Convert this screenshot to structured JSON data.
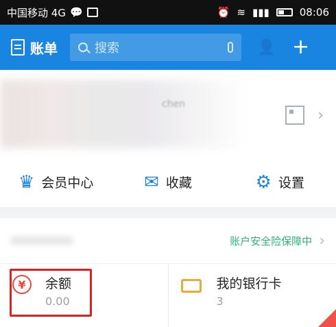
{
  "status_bar": {
    "carrier": "中国移动 4G",
    "time": "08:06"
  },
  "app_bar": {
    "title": "账单",
    "search_placeholder": "搜索"
  },
  "profile": {
    "name_fragment": "chen"
  },
  "quick_actions": {
    "vip": "会员中心",
    "favorites": "收藏",
    "settings": "设置"
  },
  "security_banner": {
    "text": "账户安全险保障中"
  },
  "cards": {
    "balance": {
      "title": "余额",
      "value": "0.00"
    },
    "bank": {
      "title": "我的银行卡",
      "value": "3"
    }
  },
  "colors": {
    "primary": "#1a85e0",
    "green": "#2db37a",
    "red": "#e24a3a",
    "orange": "#f0a63a",
    "highlight": "#e21f1f"
  }
}
